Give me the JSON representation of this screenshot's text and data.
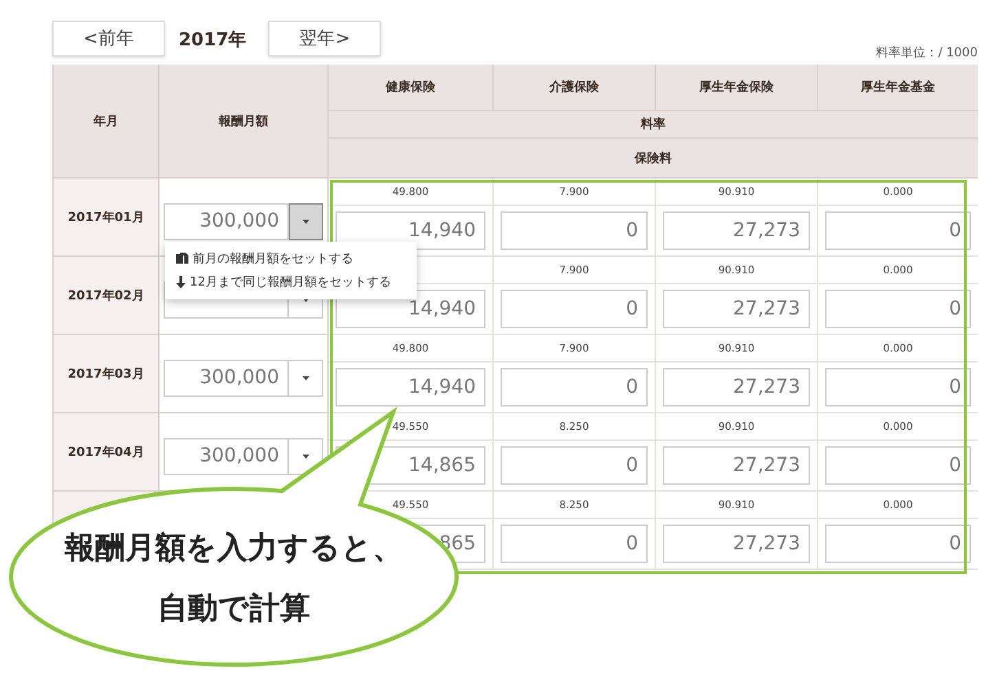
{
  "nav": {
    "prev": "<前年",
    "year": "2017年",
    "next": "翌年>"
  },
  "unit_note": "料率単位：/ 1000",
  "table": {
    "columns": [
      "年月",
      "報酬月額"
    ],
    "insurance_columns": [
      "健康保険",
      "介護保険",
      "厚生年金保険",
      "厚生年金基金"
    ],
    "rate_header": "料率",
    "premium_header": "保険料",
    "rows": [
      {
        "month": "2017年01月",
        "salary": "300,000",
        "menu_open": true,
        "cells": [
          {
            "rate": "49.800",
            "premium": "14,940"
          },
          {
            "rate": "7.900",
            "premium": "0"
          },
          {
            "rate": "90.910",
            "premium": "27,273"
          },
          {
            "rate": "0.000",
            "premium": "0"
          }
        ]
      },
      {
        "month": "2017年02月",
        "menu_open": false,
        "cells": [
          {
            "premium": "14,940"
          },
          {
            "rate": "7.900",
            "premium": "0"
          },
          {
            "rate": "90.910",
            "premium": "27,273"
          },
          {
            "rate": "0.000",
            "premium": "0"
          }
        ]
      },
      {
        "month": "2017年03月",
        "salary": "300,000",
        "menu_open": false,
        "cells": [
          {
            "rate": "49.800",
            "premium": "14,940"
          },
          {
            "rate": "7.900",
            "premium": "0"
          },
          {
            "rate": "90.910",
            "premium": "27,273"
          },
          {
            "rate": "0.000",
            "premium": "0"
          }
        ]
      },
      {
        "month": "2017年04月",
        "salary": "300,000",
        "menu_open": false,
        "cells": [
          {
            "rate": "49.550",
            "premium": "14,865"
          },
          {
            "rate": "8.250",
            "premium": "0"
          },
          {
            "rate": "90.910",
            "premium": "27,273"
          },
          {
            "rate": "0.000",
            "premium": "0"
          }
        ]
      },
      {
        "cells": [
          {
            "rate": "49.550",
            "premium": "865"
          },
          {
            "rate": "8.250",
            "premium": "0"
          },
          {
            "rate": "90.910",
            "premium": "27,273"
          },
          {
            "rate": "0.000",
            "premium": "0"
          }
        ]
      }
    ]
  },
  "menu": {
    "items": [
      {
        "kind": "copy",
        "label": "前月の報酬月額をセットする"
      },
      {
        "kind": "down",
        "label": "12月まで同じ報酬月額をセットする"
      }
    ]
  },
  "callout": {
    "lines": [
      "報酬月額を入力すると、",
      "自動で計算"
    ]
  }
}
